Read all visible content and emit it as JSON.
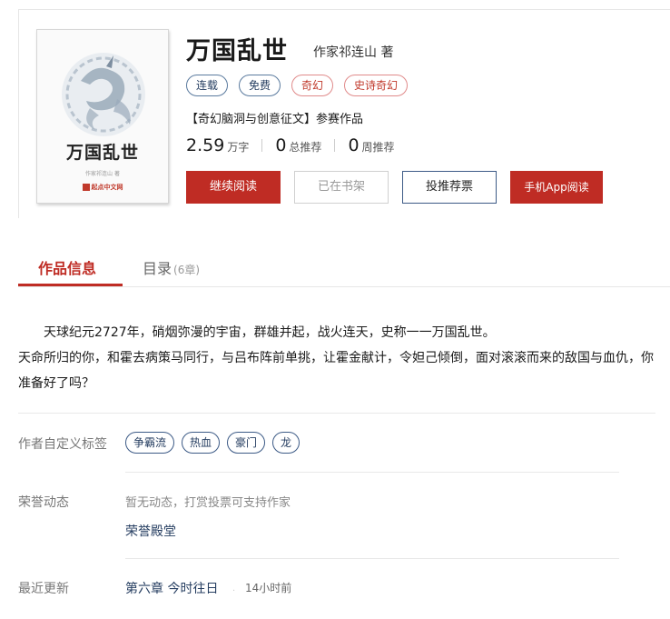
{
  "book": {
    "title": "万国乱世",
    "author": "作家祁连山 著"
  },
  "cover": {
    "title": "万国乱世",
    "author": "作家祁连山 著",
    "publisher": "起点中文网"
  },
  "tags": [
    "连载",
    "免费",
    "奇幻",
    "史诗奇幻"
  ],
  "contest": "【奇幻脑洞与创意征文】参赛作品",
  "stats": {
    "words_num": "2.59",
    "words_unit": "万字",
    "total_rec_num": "0",
    "total_rec_unit": "总推荐",
    "week_rec_num": "0",
    "week_rec_unit": "周推荐"
  },
  "buttons": {
    "continue_read": "继续阅读",
    "on_shelf": "已在书架",
    "vote": "投推荐票",
    "app_read": "手机App阅读"
  },
  "tabs": {
    "info": "作品信息",
    "toc": "目录",
    "toc_count": "(6章)"
  },
  "intro": {
    "line1": "天球纪元2727年，硝烟弥漫的宇宙，群雄并起，战火连天，史称一一万国乱世。",
    "line2": "天命所归的你，和霍去病策马同行，与吕布阵前单挑，让霍金献计，令妲己倾倒，面对滚滚而来的敌国与血仇，你准备好了吗？"
  },
  "custom_tags": {
    "label": "作者自定义标签",
    "items": [
      "争霸流",
      "热血",
      "豪门",
      "龙"
    ]
  },
  "honor": {
    "label": "荣誉动态",
    "text": "暂无动态，打赏投票可支持作家",
    "link": "荣誉殿堂"
  },
  "latest": {
    "label": "最近更新",
    "chapter": "第六章 今时往日",
    "time": "14小时前"
  },
  "colors": {
    "accent_red": "#bf2c24",
    "link_blue": "#263e61"
  }
}
